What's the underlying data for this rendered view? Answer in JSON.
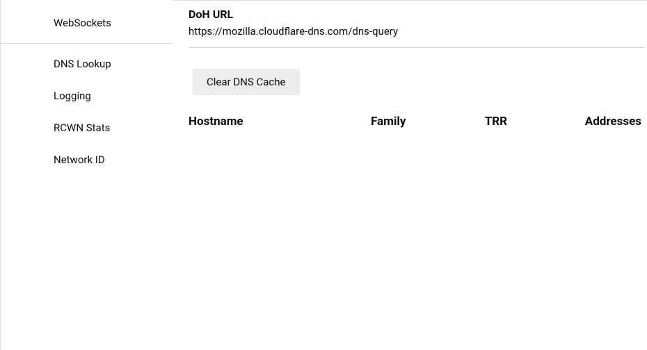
{
  "sidebar": {
    "items_top": [
      {
        "label": "WebSockets"
      }
    ],
    "items_bottom": [
      {
        "label": "DNS Lookup"
      },
      {
        "label": "Logging"
      },
      {
        "label": "RCWN Stats"
      },
      {
        "label": "Network ID"
      }
    ]
  },
  "main": {
    "doh": {
      "label": "DoH URL",
      "value": "https://mozilla.cloudflare-dns.com/dns-query"
    },
    "clear_button": "Clear DNS Cache",
    "table": {
      "columns": {
        "hostname": "Hostname",
        "family": "Family",
        "trr": "TRR",
        "addresses": "Addresses"
      }
    }
  }
}
